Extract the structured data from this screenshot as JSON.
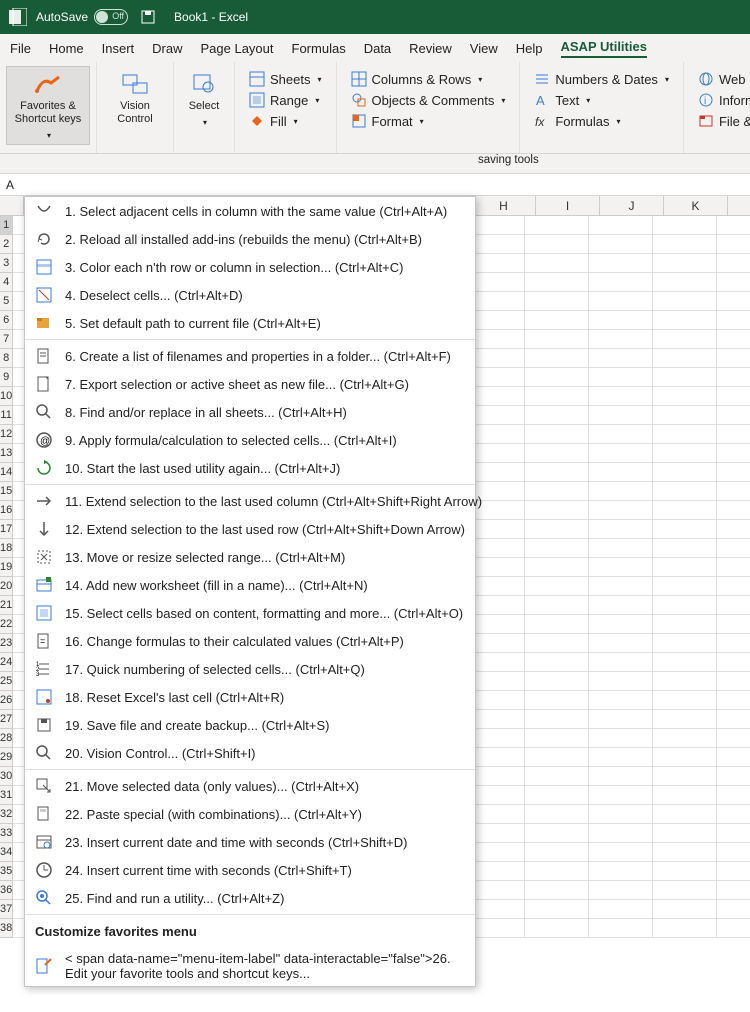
{
  "titlebar": {
    "autosave": "AutoSave",
    "autosave_state": "Off",
    "doc": "Book1  -  Excel"
  },
  "menu": {
    "file": "File",
    "home": "Home",
    "insert": "Insert",
    "draw": "Draw",
    "page_layout": "Page Layout",
    "formulas": "Formulas",
    "data": "Data",
    "review": "Review",
    "view": "View",
    "help": "Help",
    "asap": "ASAP Utilities"
  },
  "ribbon": {
    "favorites": "Favorites & Shortcut keys",
    "vision": "Vision Control",
    "select": "Select",
    "sheets": "Sheets",
    "range": "Range",
    "fill": "Fill",
    "columns_rows": "Columns & Rows",
    "objects_comments": "Objects & Comments",
    "format": "Format",
    "numbers_dates": "Numbers & Dates",
    "text": "Text",
    "formulas": "Formulas",
    "web": "Web",
    "information": "Information",
    "file_system": "File & System"
  },
  "subbar": "saving tools",
  "namebox": "A",
  "columns": [
    "H",
    "I",
    "J",
    "K"
  ],
  "row_count": 38,
  "dropdown": {
    "items": [
      {
        "n": "1.",
        "text": "Select adjacent cells in column with the same value (Ctrl+Alt+A)"
      },
      {
        "n": "2.",
        "text": "Reload all installed add-ins (rebuilds the menu) (Ctrl+Alt+B)"
      },
      {
        "n": "3.",
        "text": "Color each n'th row or column in selection... (Ctrl+Alt+C)"
      },
      {
        "n": "4.",
        "text": "Deselect cells... (Ctrl+Alt+D)"
      },
      {
        "n": "5.",
        "text": "Set default path to current file (Ctrl+Alt+E)"
      },
      {
        "n": "6.",
        "text": "Create a list of filenames and properties in a folder... (Ctrl+Alt+F)"
      },
      {
        "n": "7.",
        "text": "Export selection or active sheet as new file... (Ctrl+Alt+G)"
      },
      {
        "n": "8.",
        "text": "Find and/or replace in all sheets... (Ctrl+Alt+H)"
      },
      {
        "n": "9.",
        "text": "Apply formula/calculation to selected cells... (Ctrl+Alt+I)"
      },
      {
        "n": "10.",
        "text": "Start the last used utility again... (Ctrl+Alt+J)"
      },
      {
        "n": "11.",
        "text": "Extend selection to the last used column (Ctrl+Alt+Shift+Right Arrow)"
      },
      {
        "n": "12.",
        "text": "Extend selection to the last used row (Ctrl+Alt+Shift+Down Arrow)"
      },
      {
        "n": "13.",
        "text": "Move or resize selected range... (Ctrl+Alt+M)"
      },
      {
        "n": "14.",
        "text": "Add new worksheet (fill in a name)... (Ctrl+Alt+N)"
      },
      {
        "n": "15.",
        "text": "Select cells based on content, formatting and more... (Ctrl+Alt+O)"
      },
      {
        "n": "16.",
        "text": "Change formulas to their calculated values (Ctrl+Alt+P)"
      },
      {
        "n": "17.",
        "text": "Quick numbering of selected cells... (Ctrl+Alt+Q)"
      },
      {
        "n": "18.",
        "text": "Reset Excel's last cell (Ctrl+Alt+R)"
      },
      {
        "n": "19.",
        "text": "Save file and create backup... (Ctrl+Alt+S)"
      },
      {
        "n": "20.",
        "text": "Vision Control... (Ctrl+Shift+I)"
      },
      {
        "n": "21.",
        "text": "Move selected data (only values)... (Ctrl+Alt+X)"
      },
      {
        "n": "22.",
        "text": "Paste special (with combinations)... (Ctrl+Alt+Y)"
      },
      {
        "n": "23.",
        "text": "Insert current date and time with seconds (Ctrl+Shift+D)"
      },
      {
        "n": "24.",
        "text": "Insert current time with seconds (Ctrl+Shift+T)"
      },
      {
        "n": "25.",
        "text": "Find and run a utility... (Ctrl+Alt+Z)"
      }
    ],
    "customize_header": "Customize favorites menu",
    "edit_favorites": {
      "n": "26.",
      "text": "Edit your favorite tools and shortcut keys..."
    }
  }
}
